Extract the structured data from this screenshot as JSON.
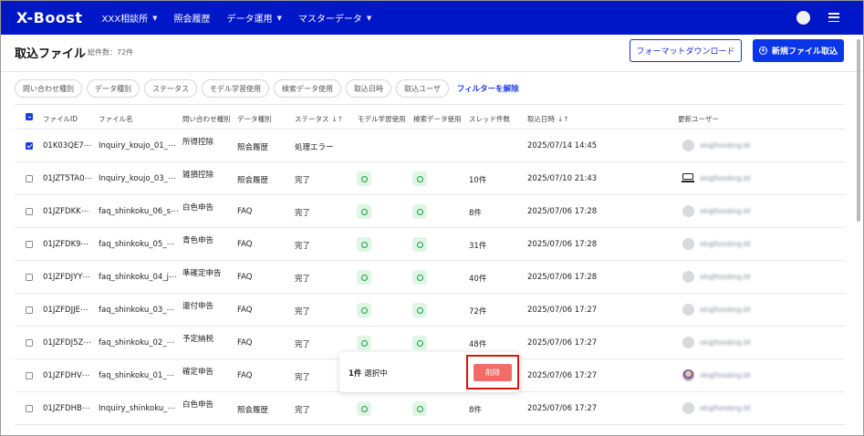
{
  "nav": {
    "logo": "X-Boost",
    "items": [
      {
        "label": "XXX相談所",
        "dropdown": true
      },
      {
        "label": "照会履歴",
        "dropdown": false
      },
      {
        "label": "データ運用",
        "dropdown": true
      },
      {
        "label": "マスターデータ",
        "dropdown": true
      }
    ]
  },
  "header": {
    "title": "取込ファイル",
    "count": "総件数：72件",
    "format_download": "フォーマットダウンロード",
    "new_import": "新規ファイル取込"
  },
  "filters": {
    "chips": [
      "問い合わせ種別",
      "データ種別",
      "ステータス",
      "モデル学習使用",
      "検索データ使用",
      "取込日時",
      "取込ユーザ"
    ],
    "clear": "フィルターを解除"
  },
  "table": {
    "columns": {
      "file_id": "ファイルID",
      "file_name": "ファイル名",
      "inquiry_type": "問い合わせ種別",
      "data_type": "データ種別",
      "status": "ステータス",
      "model": "モデル学習使用",
      "search": "検索データ使用",
      "threads": "スレッド件数",
      "imported_at": "取込日時",
      "updated_user": "更新ユーザー"
    },
    "sort_glyph": "↓↑",
    "rows": [
      {
        "checked": true,
        "file_id": "01K03QE7⋯",
        "file_name": "Inquiry_koujo_01_⋯",
        "inquiry_type": "所得控除",
        "data_type": "照会履歴",
        "status": "処理エラー",
        "model": false,
        "search": false,
        "threads": "",
        "imported_at": "2025/07/14 14:45",
        "user": "avatar",
        "user_name": "xkqjfoosbng.bt"
      },
      {
        "checked": false,
        "file_id": "01JZT5TA0⋯",
        "file_name": "Inquiry_koujo_03_⋯",
        "inquiry_type": "雑損控除",
        "data_type": "照会履歴",
        "status": "完了",
        "model": true,
        "search": true,
        "threads": "10件",
        "imported_at": "2025/07/10 21:43",
        "user": "laptop",
        "user_name": "xkqjfoosbng.bt"
      },
      {
        "checked": false,
        "file_id": "01JZFDKK⋯",
        "file_name": "faq_shinkoku_06_s⋯",
        "inquiry_type": "白色申告",
        "data_type": "FAQ",
        "status": "完了",
        "model": true,
        "search": true,
        "threads": "8件",
        "imported_at": "2025/07/06 17:28",
        "user": "avatar",
        "user_name": "xkqjfoosbng.bt"
      },
      {
        "checked": false,
        "file_id": "01JZFDK9⋯",
        "file_name": "faq_shinkoku_05_⋯",
        "inquiry_type": "青色申告",
        "data_type": "FAQ",
        "status": "完了",
        "model": true,
        "search": true,
        "threads": "31件",
        "imported_at": "2025/07/06 17:28",
        "user": "avatar",
        "user_name": "xkqjfoosbng.bt"
      },
      {
        "checked": false,
        "file_id": "01JZFDJYY⋯",
        "file_name": "faq_shinkoku_04_j⋯",
        "inquiry_type": "準確定申告",
        "data_type": "FAQ",
        "status": "完了",
        "model": true,
        "search": true,
        "threads": "40件",
        "imported_at": "2025/07/06 17:28",
        "user": "avatar",
        "user_name": "xkqjfoosbng.bt"
      },
      {
        "checked": false,
        "file_id": "01JZFDJJE⋯",
        "file_name": "faq_shinkoku_03_⋯",
        "inquiry_type": "還付申告",
        "data_type": "FAQ",
        "status": "完了",
        "model": true,
        "search": true,
        "threads": "72件",
        "imported_at": "2025/07/06 17:27",
        "user": "avatar",
        "user_name": "xkqjfoosbng.bt"
      },
      {
        "checked": false,
        "file_id": "01JZFDJ5Z⋯",
        "file_name": "faq_shinkoku_02_⋯",
        "inquiry_type": "予定納税",
        "data_type": "FAQ",
        "status": "完了",
        "model": true,
        "search": true,
        "threads": "48件",
        "imported_at": "2025/07/06 17:27",
        "user": "avatar",
        "user_name": "xkqjfoosbng.bt"
      },
      {
        "checked": false,
        "file_id": "01JZFDHV⋯",
        "file_name": "faq_shinkoku_01_⋯",
        "inquiry_type": "確定申告",
        "data_type": "FAQ",
        "status": "完了",
        "model": false,
        "search": false,
        "threads": "",
        "imported_at": "2025/07/06 17:27",
        "user": "photo",
        "user_name": "xkqjfoosbng.bt"
      },
      {
        "checked": false,
        "file_id": "01JZFDHB⋯",
        "file_name": "Inquiry_shinkoku_⋯",
        "inquiry_type": "白色申告",
        "data_type": "照会履歴",
        "status": "完了",
        "model": true,
        "search": true,
        "threads": "8件",
        "imported_at": "2025/07/06 17:27",
        "user": "avatar",
        "user_name": "xkqjfoosbng.bt"
      }
    ]
  },
  "selection": {
    "count": "1件",
    "suffix": " 選択中",
    "delete": "削除"
  },
  "colors": {
    "nav_bg": "#0017c8",
    "primary": "#0b36e8",
    "ok_badge_bg": "#dff6e4",
    "ok_badge_fg": "#1a9d47",
    "delete_bg": "#f26c67",
    "highlight_outline": "#dd1111"
  }
}
